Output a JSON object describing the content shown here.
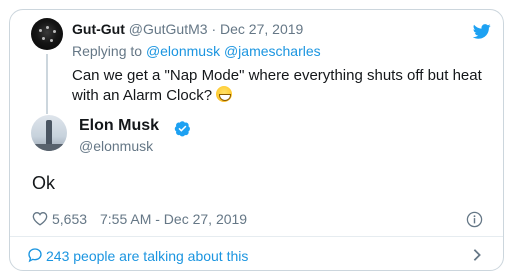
{
  "parent_tweet": {
    "display_name": "Gut-Gut",
    "handle": "@GutGutM3",
    "separator": "·",
    "date": "Dec 27, 2019",
    "replying_prefix": "Replying to",
    "mentions": [
      "@elonmusk",
      "@jamescharles"
    ],
    "text": "Can we get a \"Nap Mode\" where everything shuts off but heat with an Alarm Clock?",
    "emoji": "grinning-face-emoji"
  },
  "main_tweet": {
    "display_name": "Elon Musk",
    "verified": true,
    "handle": "@elonmusk",
    "text": "Ok",
    "like_count": "5,653",
    "timestamp": "7:55 AM - Dec 27, 2019"
  },
  "footer": {
    "talking_text": "243 people are talking about this"
  },
  "icons": {
    "brand": "twitter-bird-icon",
    "verified": "verified-badge-icon",
    "like": "heart-icon",
    "info": "info-icon",
    "conversation": "speech-bubble-icon",
    "more": "chevron-right-icon"
  },
  "colors": {
    "accent": "#1b95e0",
    "text": "#14171a",
    "muted": "#657786",
    "border": "#ccd6dd"
  }
}
